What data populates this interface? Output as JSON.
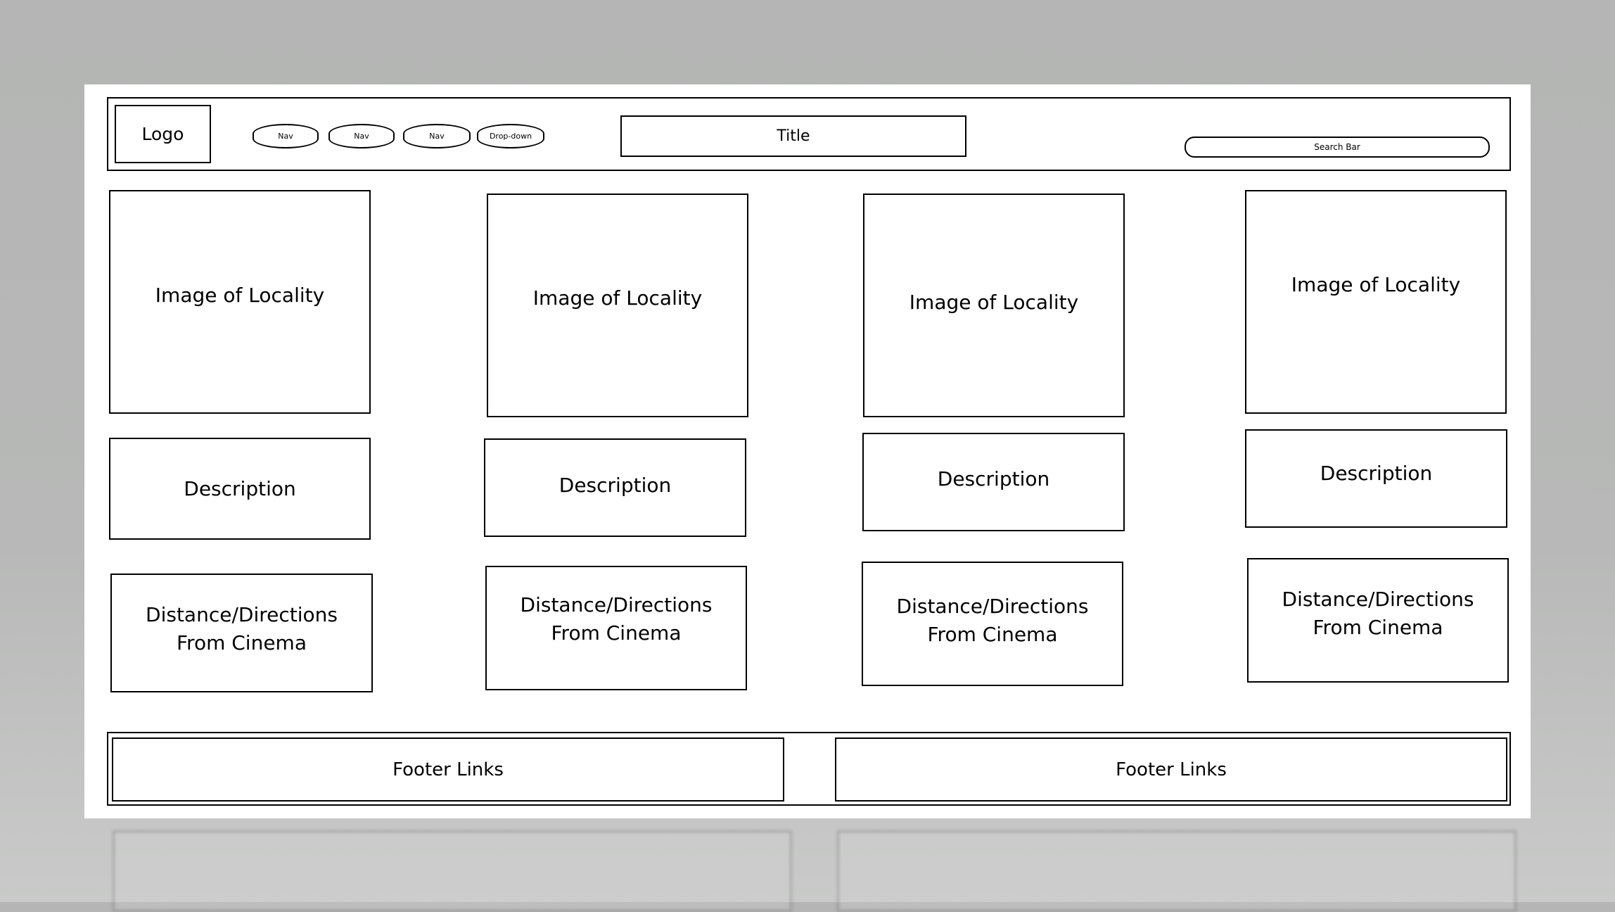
{
  "header": {
    "logo": "Logo",
    "nav_items": [
      "Nav",
      "Nav",
      "Nav",
      "Drop-down"
    ],
    "title": "Title",
    "search_placeholder": "Search Bar"
  },
  "columns": [
    {
      "image": "Image of Locality",
      "description": "Description",
      "directions": [
        "Distance/Directions",
        "From Cinema"
      ]
    },
    {
      "image": "Image of Locality",
      "description": "Description",
      "directions": [
        "Distance/Directions",
        "From Cinema"
      ]
    },
    {
      "image": "Image of Locality",
      "description": "Description",
      "directions": [
        "Distance/Directions",
        "From Cinema"
      ]
    },
    {
      "image": "Image of Locality",
      "description": "Description",
      "directions": [
        "Distance/Directions",
        "From Cinema"
      ]
    }
  ],
  "footer": {
    "links": [
      "Footer Links",
      "Footer Links"
    ]
  }
}
